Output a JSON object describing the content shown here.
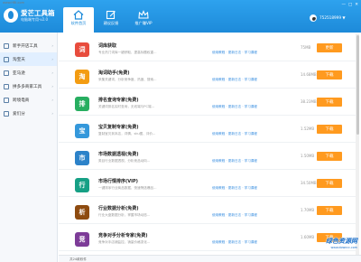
{
  "watermark_top": "www.HBI.com",
  "app": {
    "title": "爱芒工具箱",
    "subtitle": "电脑端专用·v2.0"
  },
  "nav_tabs": [
    {
      "label": "软件首页",
      "icon": "home-icon"
    },
    {
      "label": "建议反馈",
      "icon": "edit-icon"
    },
    {
      "label": "推广赚VIP",
      "icon": "crown-icon"
    }
  ],
  "user": {
    "id": "752518999",
    "dropdown": "▼"
  },
  "window_controls": [
    "—",
    "□",
    "✕"
  ],
  "sidebar": [
    {
      "label": "新手开店工具",
      "icon": "store-icon"
    },
    {
      "label": "淘宝天",
      "icon": "taobao-icon"
    },
    {
      "label": "亚马逊",
      "icon": "amazon-icon"
    },
    {
      "label": "拼多多商家工具",
      "icon": "pdd-icon"
    },
    {
      "label": "跨境电商",
      "icon": "globe-icon"
    },
    {
      "label": "爱们分",
      "icon": "share-icon"
    }
  ],
  "rows": [
    {
      "title": "词库获取",
      "desc": "专业热门词库一键获取，提高标题权重...",
      "links": "使用教程 · 更新日志 · 学习课程",
      "size": "75MB",
      "action": "更新",
      "color": "#e84c3d",
      "glyph": "词"
    },
    {
      "title": "淘词助手(免费)",
      "desc": "采集关键词，分析竞争度、热度、搜索...",
      "links": "使用教程 · 更新日志 · 学习课程",
      "size": "14.68MB",
      "action": "下载",
      "color": "#f39c12",
      "glyph": "淘"
    },
    {
      "title": "排名查询专家(免费)",
      "desc": "关键词排名实时查询，无线端与PC端...",
      "links": "使用教程 · 更新日志 · 学习课程",
      "size": "38.23MB",
      "action": "下载",
      "color": "#27ae60",
      "glyph": "排"
    },
    {
      "title": "宝贝复制专家(免费)",
      "desc": "复制宝贝到本店，详情、sku图、评价...",
      "links": "使用教程 · 更新日志 · 学习课程",
      "size": "1.52MB",
      "action": "下载",
      "color": "#3498db",
      "glyph": "宝"
    },
    {
      "title": "市场数据透视(免费)",
      "desc": "类目行业数据透视，分析竞品动向...",
      "links": "使用教程 · 更新日志 · 学习课程",
      "size": "1.50MB",
      "action": "下载",
      "color": "#2c82c9",
      "glyph": "市"
    },
    {
      "title": "市场行情排序(VIP)",
      "desc": "一键排序行业商品数据，快速筛选爆品...",
      "links": "使用教程 · 更新日志 · 学习课程",
      "size": "34.50MB",
      "action": "下载",
      "color": "#16a085",
      "glyph": "行"
    },
    {
      "title": "行业数据分析(免费)",
      "desc": "行业大盘数据分析，掌握市场动态...",
      "links": "使用教程 · 更新日志 · 学习课程",
      "size": "1.70MB",
      "action": "下载",
      "color": "#8e4b10",
      "glyph": "析"
    },
    {
      "title": "竞争对手分析专家(免费)",
      "desc": "竞争对手店铺监控，销量价格变化...",
      "links": "使用教程 · 更新日志 · 学习课程",
      "size": "1.60MB",
      "action": "下载",
      "color": "#7d3c98",
      "glyph": "竞"
    }
  ],
  "status": "共24款软件",
  "watermark_logo": {
    "main": "绿色资源网",
    "sub": "www.downcc.com"
  }
}
